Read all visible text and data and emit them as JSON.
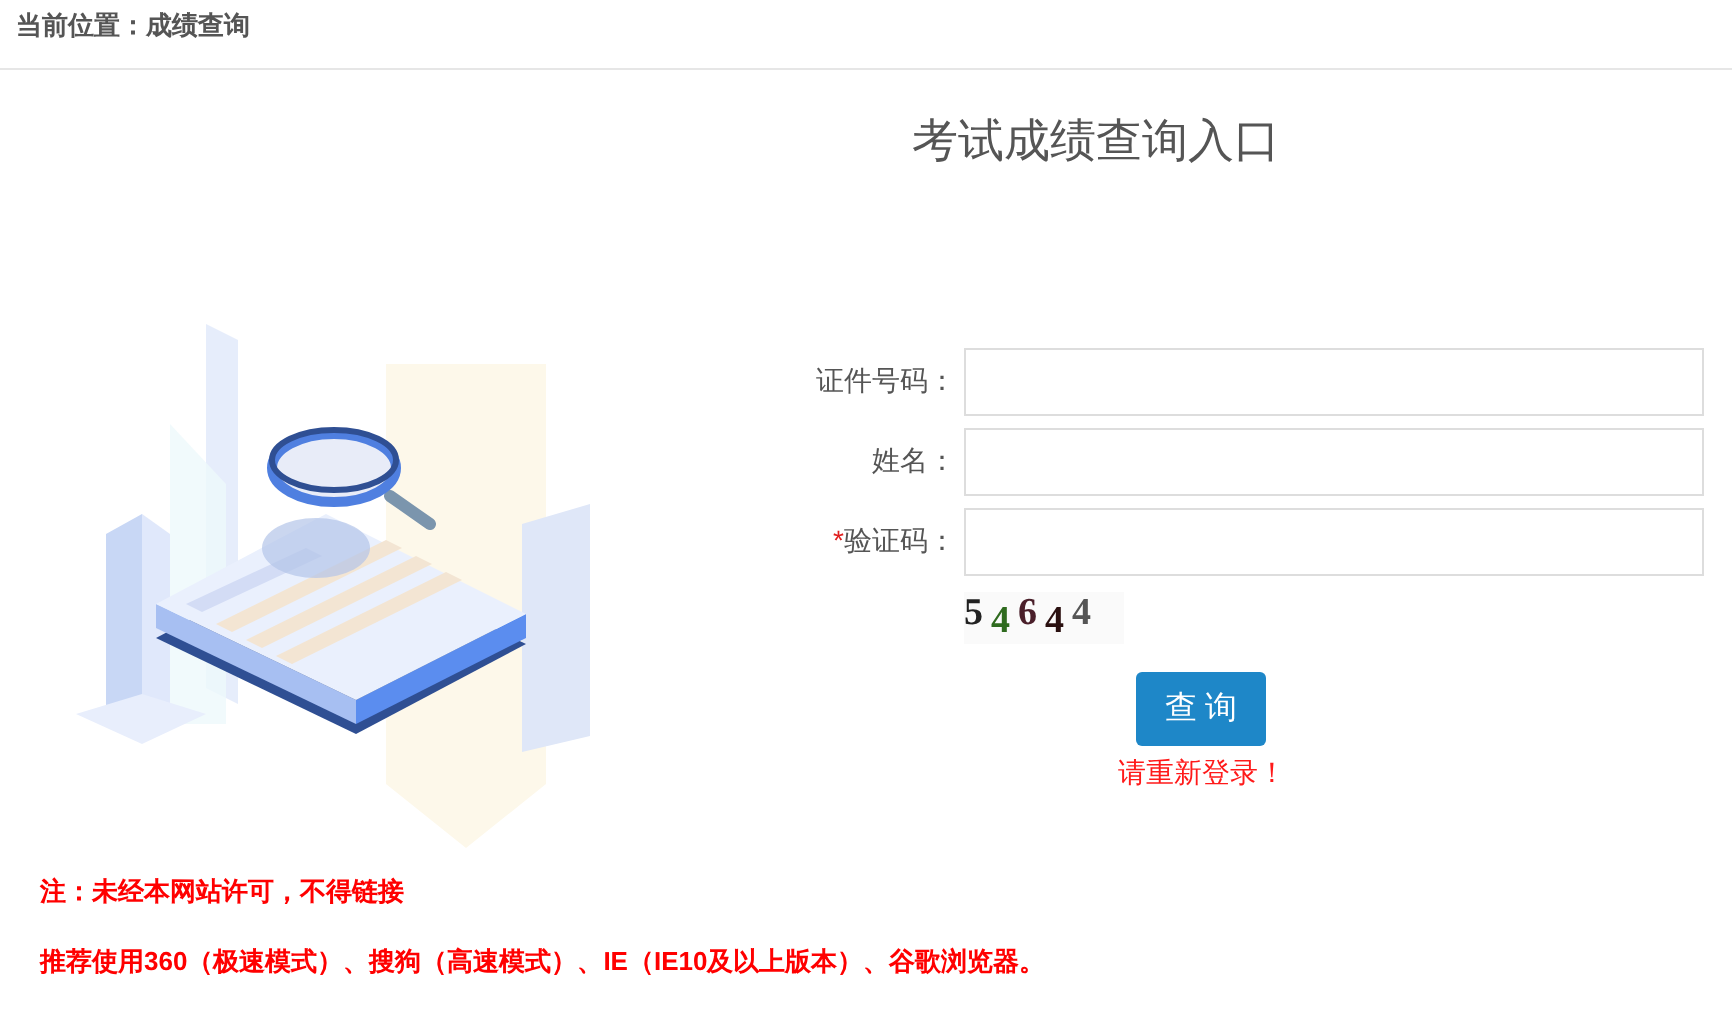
{
  "breadcrumb": "当前位置：成绩查询",
  "title": "考试成绩查询入口",
  "fields": [
    {
      "label": "证件号码：",
      "required": false
    },
    {
      "label": "姓名：",
      "required": false
    },
    {
      "label": "验证码：",
      "required": true
    }
  ],
  "required_mark": "*",
  "captcha": "54644",
  "submit": "查 询",
  "error": "请重新登录！",
  "notes": [
    "注：未经本网站许可，不得链接",
    "推荐使用360（极速模式）、搜狗（高速模式）、IE（IE10及以上版本）、谷歌浏览器。"
  ]
}
